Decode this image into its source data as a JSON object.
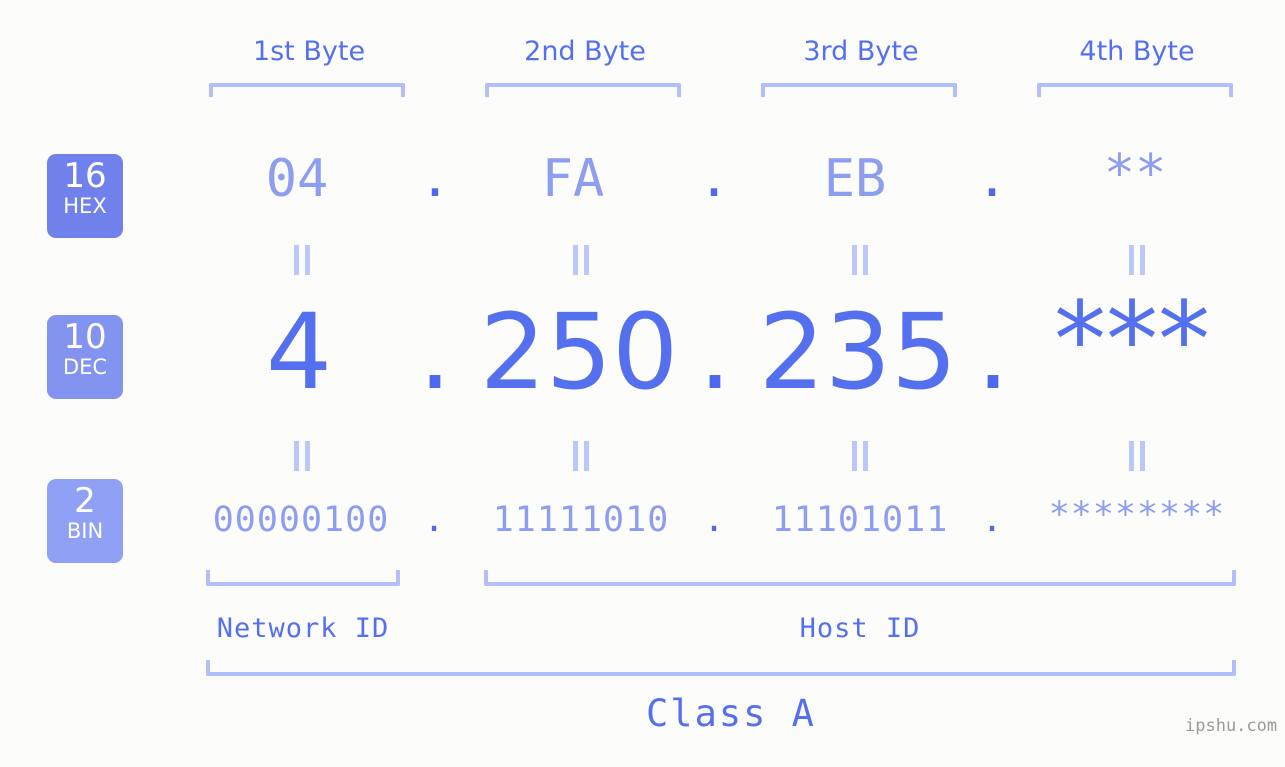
{
  "background_color": "#fcfdfa",
  "accent_color": "#5570ef",
  "light_accent_color": "#8d9df0",
  "bracket_color": "#b3bffb",
  "byte_headers": [
    {
      "label": "1st Byte"
    },
    {
      "label": "2nd Byte"
    },
    {
      "label": "3rd Byte"
    },
    {
      "label": "4th Byte"
    }
  ],
  "rows": {
    "hex": {
      "badge_number": "16",
      "badge_radix": "HEX",
      "values": [
        "04",
        "FA",
        "EB",
        "**"
      ],
      "separator": "."
    },
    "dec": {
      "badge_number": "10",
      "badge_radix": "DEC",
      "values": [
        "4",
        "250",
        "235",
        "***"
      ],
      "separator": "."
    },
    "bin": {
      "badge_number": "2",
      "badge_radix": "BIN",
      "values": [
        "00000100",
        "11111010",
        "11101011",
        "********"
      ],
      "separator": "."
    }
  },
  "equals_marks": {
    "symbol": "||",
    "count_per_gap": 4
  },
  "id_sections": [
    {
      "label": "Network ID"
    },
    {
      "label": "Host ID"
    }
  ],
  "class_label": "Class A",
  "watermark": "ipshu.com"
}
